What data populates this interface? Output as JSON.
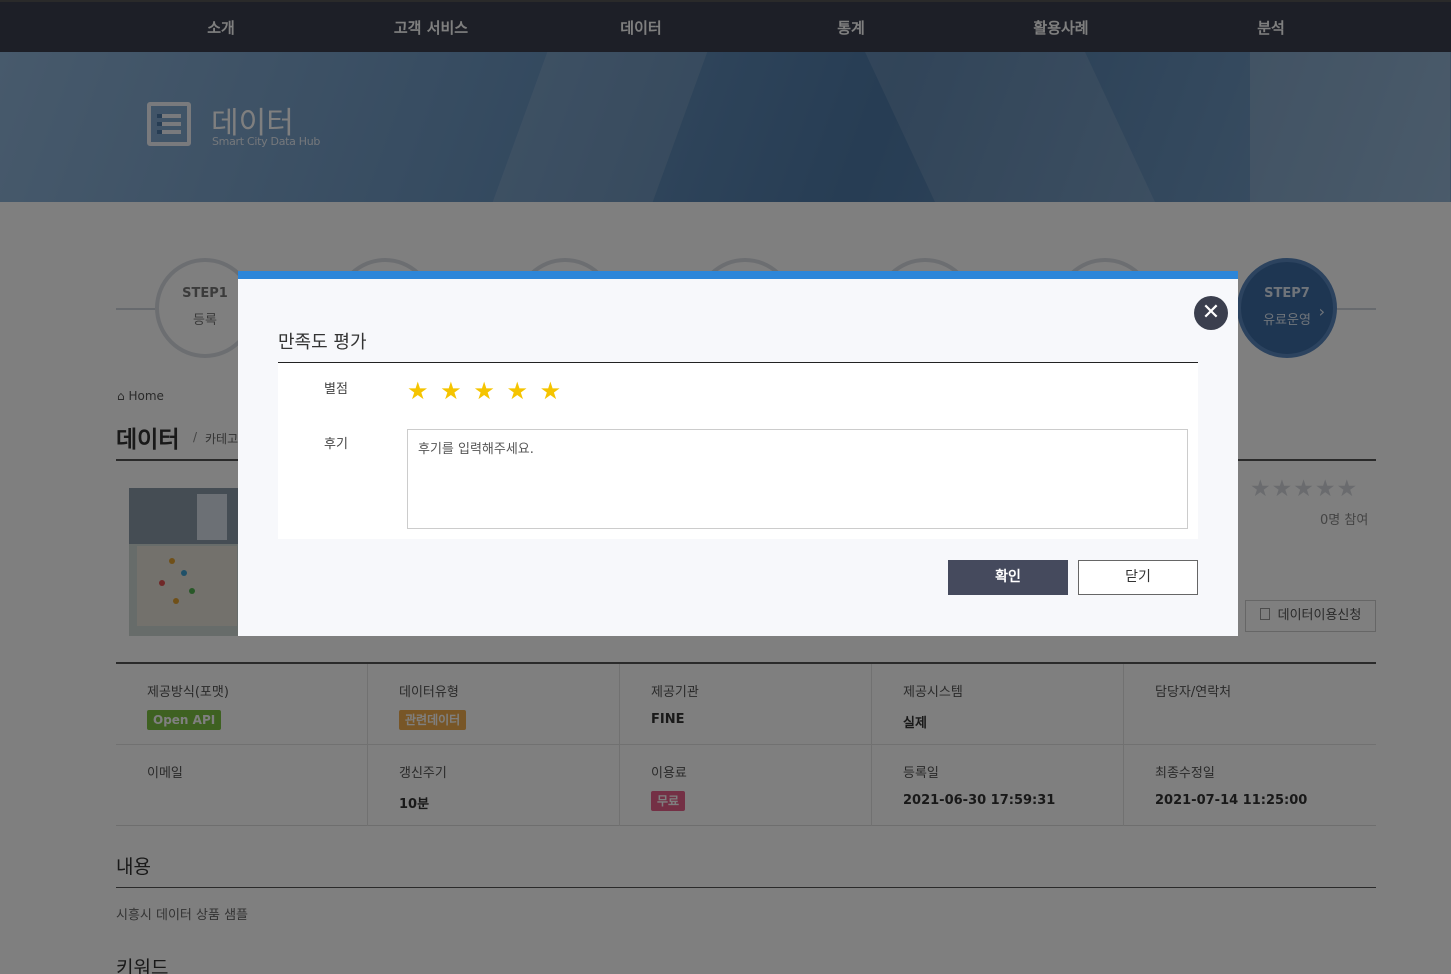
{
  "nav": {
    "items": [
      "소개",
      "고객 서비스",
      "데이터",
      "통계",
      "활용사례",
      "분석"
    ]
  },
  "hero": {
    "title": "데이터",
    "subtitle": "Smart City Data Hub",
    "icon": "list-icon"
  },
  "steps": [
    {
      "num": "STEP1",
      "label": "등록"
    },
    {
      "num": "STEP7",
      "label": "유료운영"
    }
  ],
  "breadcrumb": {
    "home": "Home",
    "home_icon": "home-icon"
  },
  "page": {
    "title": "데이터",
    "separator": "/",
    "category": "카테고"
  },
  "rating_summary": {
    "stars": "★★★★★",
    "participants": "0명 참여"
  },
  "apply_button": {
    "label": "데이터이용신청",
    "icon": "document-icon"
  },
  "info": [
    {
      "label": "제공방식(포맷)",
      "badge": "Open API",
      "badge_color": "#7cc243"
    },
    {
      "label": "데이터유형",
      "badge": "관련데이터",
      "badge_color": "#f0ad4e"
    },
    {
      "label": "제공기관",
      "value": "FINE"
    },
    {
      "label": "제공시스템",
      "value": "실제"
    },
    {
      "label": "담당자/연락처",
      "value": ""
    },
    {
      "label": "이메일",
      "value": ""
    },
    {
      "label": "갱신주기",
      "value": "10분"
    },
    {
      "label": "이용료",
      "badge": "무료",
      "badge_color": "#e8608a"
    },
    {
      "label": "등록일",
      "value": "2021-06-30 17:59:31"
    },
    {
      "label": "최종수정일",
      "value": "2021-07-14 11:25:00"
    }
  ],
  "content": {
    "title": "내용",
    "text": "시흥시 데이터 상품 샘플"
  },
  "keyword": {
    "title": "키워드"
  },
  "modal": {
    "title": "만족도 평가",
    "rating_label": "별점",
    "rating_value": 5,
    "rating_max": 5,
    "star": "★",
    "review_label": "후기",
    "review_placeholder": "후기를 입력해주세요.",
    "review_value": "",
    "confirm": "확인",
    "cancel": "닫기",
    "close": "✕",
    "accent_color": "#2d86d9"
  }
}
